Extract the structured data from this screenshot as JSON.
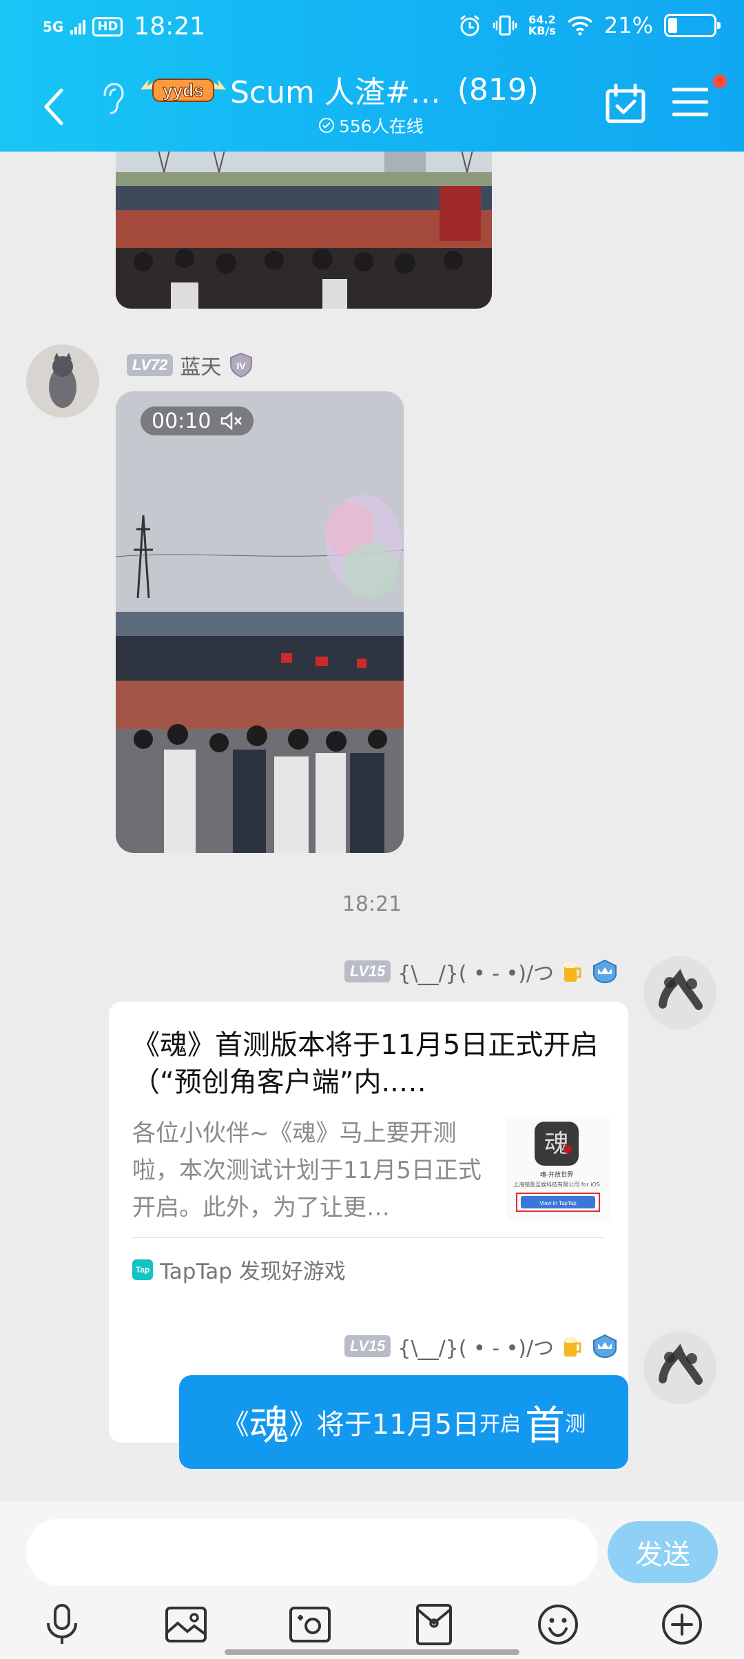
{
  "status_bar": {
    "network": "5G",
    "hd": "HD",
    "time": "18:21",
    "speed_value": "64.2",
    "speed_unit": "KB/s",
    "battery_pct": "21%",
    "battery_level": 0.21
  },
  "header": {
    "badge_text": "yyds",
    "title": "Scum 人渣#…",
    "member_count": "(819)",
    "online": "556人在线"
  },
  "messages": {
    "sender1": {
      "level": "LV72",
      "name": "蓝天",
      "badge": "IV"
    },
    "video": {
      "duration": "00:10"
    },
    "timestamp": "18:21",
    "sender2": {
      "level": "LV15",
      "name": "{\\__/}( • - •)/つ"
    },
    "card": {
      "title": "《魂》首测版本将于11月5日正式开启（“预创角客户端”内..…",
      "desc": "各位小伙伴~《魂》马上要开测啦，本次测试计划于11月5日正式开启。此外，为了让更…",
      "thumb_title": "魂-开放世界",
      "thumb_company": "上海铭氪互娱科技有限公司 for iOS",
      "thumb_button": "View in TapTap",
      "source_logo": "Tap",
      "source": "TapTap 发现好游戏"
    },
    "sender3": {
      "level": "LV15",
      "name": "{\\__/}( • - •)/つ"
    },
    "bubble": {
      "part1": "《",
      "part2": "魂",
      "part3": "》将于11月5日",
      "part4": "开启",
      "part5": "首",
      "part6": "测"
    }
  },
  "input": {
    "placeholder": "",
    "send_label": "发送"
  },
  "toolbar": [
    "mic-icon",
    "image-icon",
    "camera-icon",
    "red-packet-icon",
    "emoji-icon",
    "plus-icon"
  ],
  "colors": {
    "header": "#13b4f4",
    "bubble": "#1298ee",
    "send": "#8fd0f6"
  }
}
